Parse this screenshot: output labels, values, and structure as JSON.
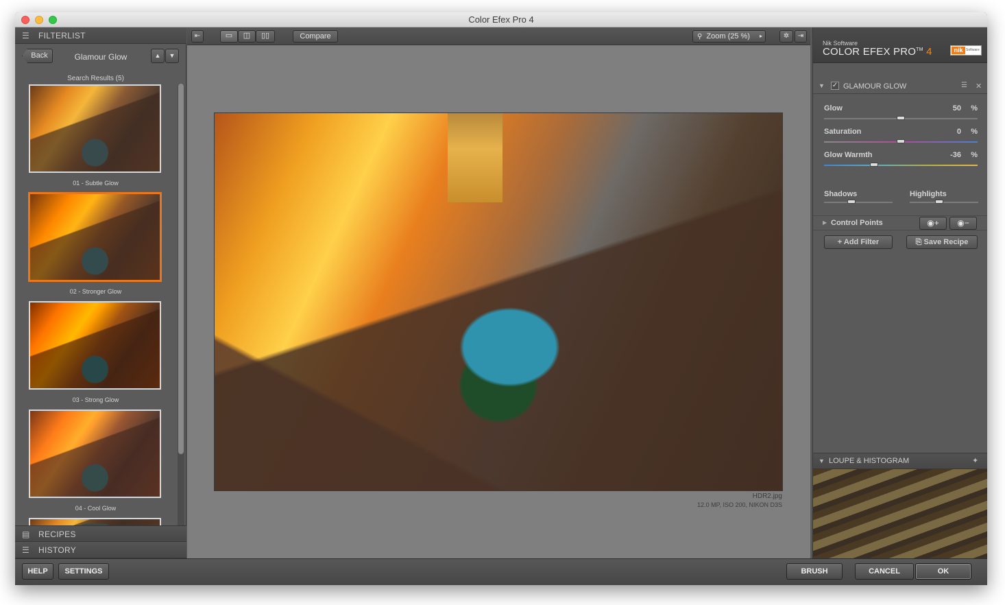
{
  "window": {
    "title": "Color Efex Pro 4"
  },
  "left_panel": {
    "filterlist_header": "FILTERLIST",
    "back_label": "Back",
    "current_filter": "Glamour Glow",
    "search_results": "Search Results (5)",
    "thumbnails": [
      {
        "label": "01 - Subtle Glow",
        "selected": false
      },
      {
        "label": "02 - Stronger Glow",
        "selected": true
      },
      {
        "label": "03 - Strong Glow",
        "selected": false
      },
      {
        "label": "04 - Cool Glow",
        "selected": false
      }
    ],
    "recipes_header": "RECIPES",
    "history_header": "HISTORY"
  },
  "toolbar": {
    "compare_label": "Compare",
    "zoom_label": "Zoom (25 %)"
  },
  "preview": {
    "filename": "HDR2.jpg",
    "info": "12.0 MP, ISO 200, NIKON D3S"
  },
  "right_panel": {
    "brand_small": "Nik Software",
    "brand_main": "COLOR EFEX PRO",
    "brand_tm": "TM",
    "brand_version": "4",
    "logo_text": "nik",
    "logo_small": "Software",
    "filter_name": "GLAMOUR GLOW",
    "filter_enabled": true,
    "sliders": [
      {
        "name": "Glow",
        "value": "50",
        "unit": "%"
      },
      {
        "name": "Saturation",
        "value": "0",
        "unit": "%"
      },
      {
        "name": "Glow Warmth",
        "value": "-36",
        "unit": "%"
      }
    ],
    "shadows_label": "Shadows",
    "highlights_label": "Highlights",
    "control_points_label": "Control Points",
    "add_filter_label": "Add Filter",
    "save_recipe_label": "Save Recipe",
    "loupe_header": "LOUPE & HISTOGRAM"
  },
  "bottom_bar": {
    "help_label": "HELP",
    "settings_label": "SETTINGS",
    "brush_label": "BRUSH",
    "cancel_label": "CANCEL",
    "ok_label": "OK"
  },
  "colors": {
    "accent": "#e8781e",
    "panel": "#5a5a5a",
    "preview_bg": "#7f7f7f"
  }
}
